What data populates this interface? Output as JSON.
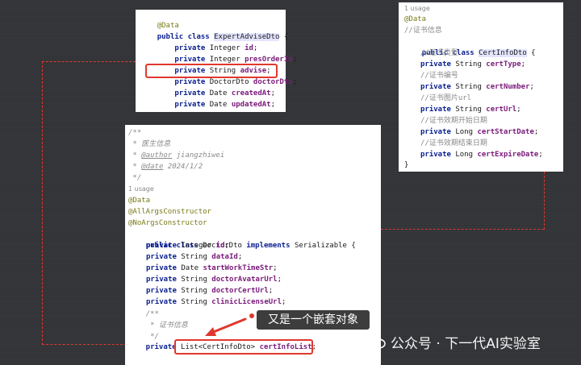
{
  "expert_panel": {
    "lines": [
      [
        "@Data"
      ],
      [
        "public class ",
        "ExpertAdviseDto",
        " {"
      ],
      [
        "    private ",
        "Integer ",
        "id",
        ";"
      ],
      [
        "    private ",
        "Integer ",
        "presOrderId",
        ";"
      ],
      [
        "    private ",
        "String ",
        "advise",
        ";"
      ],
      [
        "    private ",
        "DoctorDto ",
        "doctorDto",
        ";"
      ],
      [
        "    private ",
        "Date ",
        "createdAt",
        ";"
      ],
      [
        "    private ",
        "Date ",
        "updatedAt",
        ";"
      ]
    ]
  },
  "cert_panel": {
    "usage": "1 usage",
    "annotation": "@Data",
    "class_comment": "//证书信息",
    "class_decl": [
      "public class ",
      "CertInfoDto",
      " {"
    ],
    "fields": [
      {
        "comment": "//证书类型",
        "type": "String ",
        "name": "certType"
      },
      {
        "comment": "//证书编号",
        "type": "String ",
        "name": "certNumber"
      },
      {
        "comment": "//证书图片url",
        "type": "String ",
        "name": "certUrl"
      },
      {
        "comment": "//证书效期开始日期",
        "type": "Long ",
        "name": "certStartDate"
      },
      {
        "comment": "//证书效期结束日期",
        "type": "Long ",
        "name": "certExpireDate"
      }
    ],
    "close": "}"
  },
  "doctor_panel": {
    "doc_open": "/**",
    "doc_title": " * 医生信息",
    "author_tag": "@author",
    "author": " jiangzhiwei",
    "date_tag": "@date",
    "date": " 2024/1/2",
    "doc_close": " */",
    "usage": "1 usage",
    "annotations": [
      "@Data",
      "@AllArgsConstructor",
      "@NoArgsConstructor"
    ],
    "class_decl": [
      "public class ",
      "DoctorDto ",
      "implements ",
      "Serializable {"
    ],
    "fields": [
      {
        "type": "Integer ",
        "name": "id"
      },
      {
        "type": "String ",
        "name": "dataId"
      },
      {
        "type": "Date ",
        "name": "startWorkTimeStr"
      },
      {
        "type": "String ",
        "name": "doctorAvatarUrl"
      },
      {
        "type": "String ",
        "name": "doctorCertUrl"
      },
      {
        "type": "String ",
        "name": "clinicLicenseUrl"
      }
    ],
    "inner_doc": [
      "    /**",
      "     * 证书信息",
      "     */"
    ],
    "last_field": {
      "kw": "    private ",
      "type": "List<CertInfoDto> ",
      "name": "certInfoList",
      "end": ";"
    }
  },
  "callout_text": "又是一个嵌套对象",
  "watermark": "公众号 · 下一代AI实验室",
  "colors": {
    "highlight": "#e0382e",
    "keyword": "#0a1f8f",
    "field": "#7a1a7a",
    "annotation": "#7a7a1a"
  }
}
